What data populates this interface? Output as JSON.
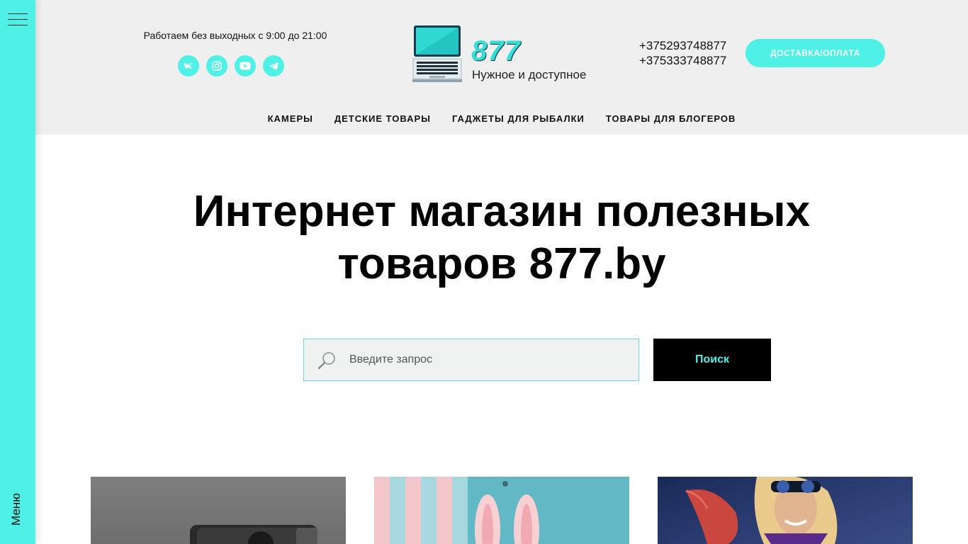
{
  "sidebar": {
    "menu_label": "Меню"
  },
  "header": {
    "hours": "Работаем без выходных с 9:00 до 21:00",
    "socials": [
      "vk-icon",
      "instagram-icon",
      "youtube-icon",
      "telegram-icon"
    ],
    "logo": {
      "number": "877",
      "tagline": "Нужное и доступное"
    },
    "phones": [
      "+375293748877",
      "+375333748877"
    ],
    "delivery_button": "ДОСТАВКА/ОПЛАТА",
    "nav": [
      "КАМЕРЫ",
      "ДЕТСКИЕ ТОВАРЫ",
      "ГАДЖЕТЫ ДЛЯ РЫБАЛКИ",
      "ТОВАРЫ ДЛЯ БЛОГЕРОВ"
    ]
  },
  "hero": {
    "title_line1": "Интернет магазин полезных",
    "title_line2": "товаров 877.by"
  },
  "search": {
    "placeholder": "Введите запрос",
    "button": "Поиск"
  },
  "colors": {
    "accent": "#4ff0e6",
    "header_bg": "#efefef",
    "button_dark": "#000000"
  }
}
